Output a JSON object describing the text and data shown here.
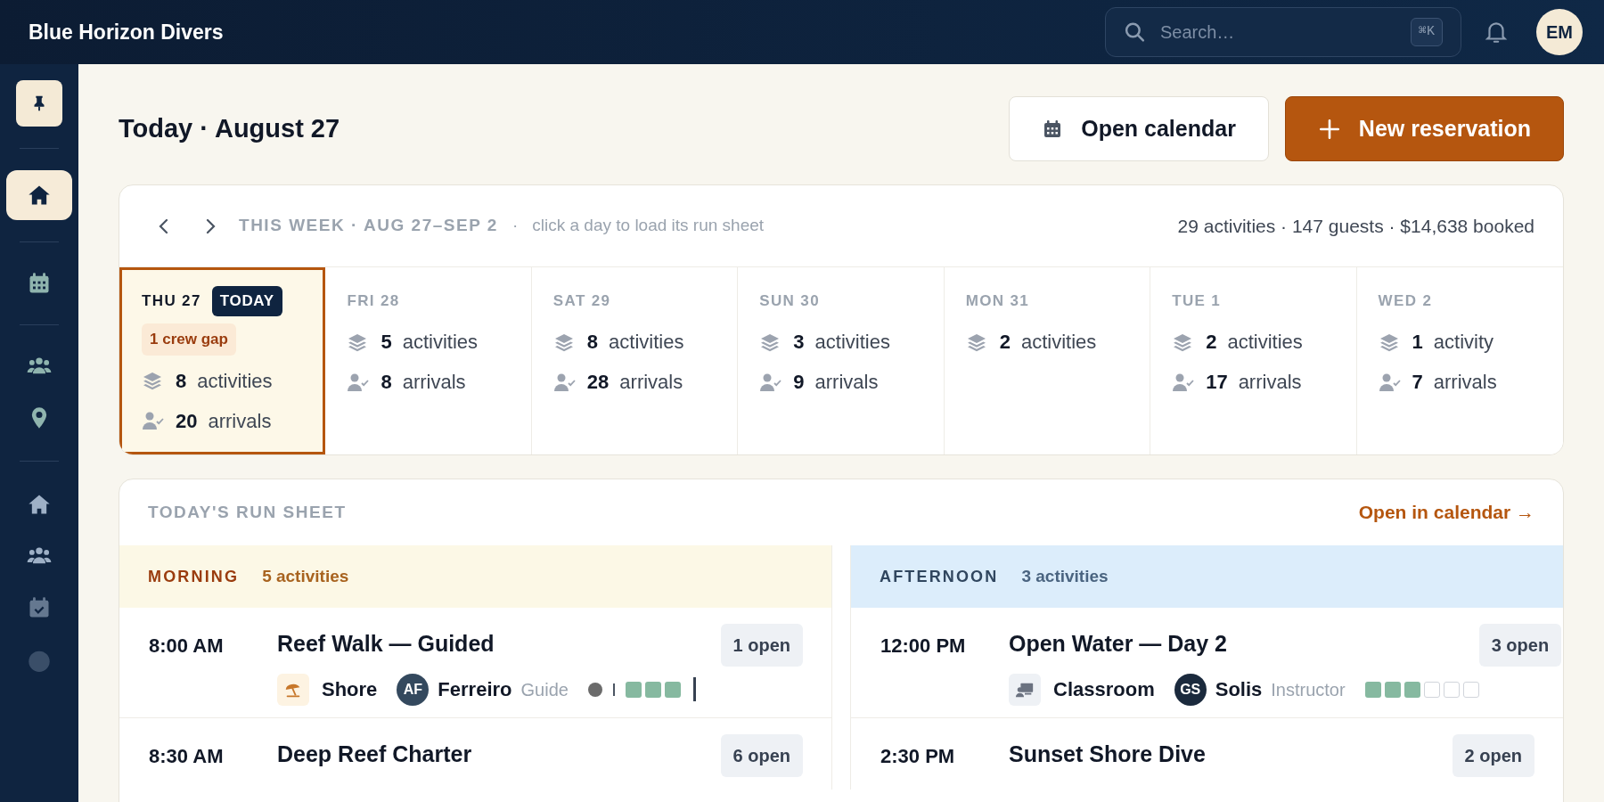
{
  "app": {
    "title": "Blue Horizon Divers",
    "search": {
      "placeholder": "Search…",
      "shortcut": "⌘K"
    },
    "avatar": "EM"
  },
  "sidebar": {
    "groups": [
      [
        {
          "kind": "pin",
          "selected": true
        }
      ],
      [
        {
          "kind": "home",
          "selected": true
        }
      ],
      [
        {
          "kind": "calendar",
          "selected": false
        }
      ],
      [
        {
          "kind": "people",
          "selected": false
        },
        {
          "kind": "location",
          "selected": false
        }
      ],
      [
        {
          "kind": "home",
          "selected": false
        },
        {
          "kind": "people",
          "selected": false
        },
        {
          "kind": "calendar-check",
          "selected": false
        },
        {
          "kind": "faded",
          "selected": false
        }
      ]
    ]
  },
  "page": {
    "title": "Today · August 27",
    "buttons": [
      {
        "label": "Open calendar",
        "kind": "secondary"
      },
      {
        "label": "New reservation",
        "kind": "primary"
      }
    ]
  },
  "week": {
    "range": "THIS WEEK · AUG 27–SEP 2",
    "separator": "·",
    "hint": "click a day to load its run sheet",
    "summary": "29 activities · 147 guests · $14,638 booked",
    "days": [
      {
        "label": "THU 27",
        "today_badge": "TODAY",
        "selected": true,
        "alert": "1 crew gap",
        "stats": [
          {
            "kind": "activities",
            "value": "8",
            "unit": "activities"
          },
          {
            "kind": "arrivals",
            "value": "20",
            "unit": "arrivals"
          }
        ]
      },
      {
        "label": "FRI 28",
        "selected": false,
        "stats": [
          {
            "kind": "activities",
            "value": "5",
            "unit": "activities"
          },
          {
            "kind": "arrivals",
            "value": "8",
            "unit": "arrivals"
          }
        ]
      },
      {
        "label": "SAT 29",
        "selected": false,
        "stats": [
          {
            "kind": "activities",
            "value": "8",
            "unit": "activities"
          },
          {
            "kind": "arrivals",
            "value": "28",
            "unit": "arrivals"
          }
        ]
      },
      {
        "label": "SUN 30",
        "selected": false,
        "stats": [
          {
            "kind": "activities",
            "value": "3",
            "unit": "activities"
          },
          {
            "kind": "arrivals",
            "value": "9",
            "unit": "arrivals"
          }
        ]
      },
      {
        "label": "MON 31",
        "selected": false,
        "stats": [
          {
            "kind": "activities",
            "value": "2",
            "unit": "activities"
          }
        ]
      },
      {
        "label": "TUE 1",
        "selected": false,
        "stats": [
          {
            "kind": "activities",
            "value": "2",
            "unit": "activities"
          },
          {
            "kind": "arrivals",
            "value": "17",
            "unit": "arrivals"
          }
        ]
      },
      {
        "label": "WED 2",
        "selected": false,
        "stats": [
          {
            "kind": "activities",
            "value": "1",
            "unit": "activity"
          },
          {
            "kind": "arrivals",
            "value": "7",
            "unit": "arrivals"
          }
        ]
      }
    ]
  },
  "run_sheet": {
    "title": "TODAY'S RUN SHEET",
    "link": "Open in calendar →",
    "sections": [
      {
        "kind": "morning",
        "label": "MORNING",
        "count": "5 activities",
        "rows": [
          {
            "time": "8:00 AM",
            "title": "Reef Walk — Guided",
            "open": "1 open",
            "location": {
              "kind": "shore",
              "label": "Shore"
            },
            "staff": {
              "initials": "AF",
              "name": "Ferreiro",
              "role": "Guide"
            },
            "seats": [
              {
                "kind": "dot"
              },
              {
                "kind": "tick"
              },
              {
                "kind": "seat",
                "filled": true
              },
              {
                "kind": "seat",
                "filled": true
              },
              {
                "kind": "seat",
                "filled": true
              },
              {
                "kind": "bar"
              }
            ]
          },
          {
            "time": "8:30 AM",
            "title": "Deep Reef Charter",
            "open": "6 open"
          }
        ]
      },
      {
        "kind": "afternoon",
        "label": "AFTERNOON",
        "count": "3 activities",
        "rows": [
          {
            "time": "12:00 PM",
            "title": "Open Water — Day 2",
            "open": "3 open",
            "location": {
              "kind": "classroom",
              "label": "Classroom"
            },
            "staff": {
              "initials": "GS",
              "name": "Solis",
              "role": "Instructor"
            },
            "seats": [
              {
                "kind": "seat",
                "filled": true
              },
              {
                "kind": "seat",
                "filled": true
              },
              {
                "kind": "seat",
                "filled": true
              },
              {
                "kind": "seat",
                "filled": false
              },
              {
                "kind": "seat",
                "filled": false
              },
              {
                "kind": "seat",
                "filled": false
              }
            ]
          },
          {
            "time": "2:30 PM",
            "title": "Sunset Shore Dive",
            "open": "2 open"
          }
        ]
      }
    ]
  }
}
